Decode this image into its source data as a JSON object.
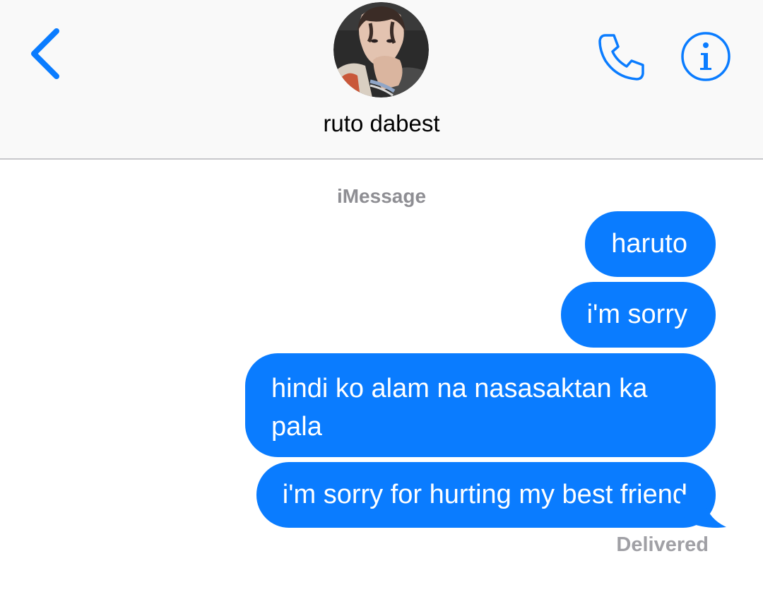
{
  "header": {
    "contact_name": "ruto dabest",
    "back_icon": "chevron-left-icon",
    "call_icon": "phone-icon",
    "info_icon": "info-icon"
  },
  "thread": {
    "service_label": "iMessage",
    "messages": [
      {
        "sender": "me",
        "text": "haruto"
      },
      {
        "sender": "me",
        "text": "i'm sorry"
      },
      {
        "sender": "me",
        "text": "hindi ko alam na nasasaktan ka pala"
      },
      {
        "sender": "me",
        "text": "i'm sorry for hurting my best friend"
      }
    ],
    "status": "Delivered"
  },
  "colors": {
    "accent": "#0a7cff",
    "bubble_text": "#ffffff",
    "secondary_text": "#8e8e93",
    "header_bg": "#f9f9f9"
  }
}
